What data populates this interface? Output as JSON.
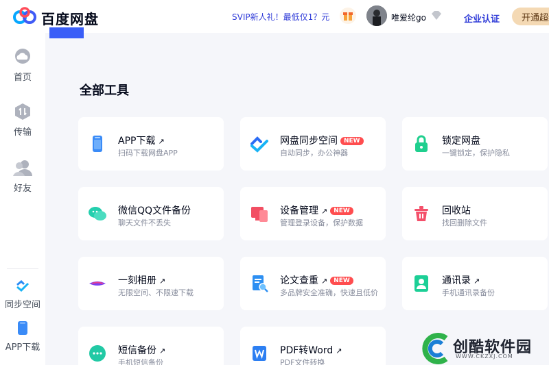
{
  "header": {
    "brand": "百度网盘",
    "promo": "SVIP新人礼！最低仅1？元",
    "username": "唯爱纶go",
    "enterprise": "企业认证",
    "open_button": "开通超级"
  },
  "sidebar": {
    "items": [
      {
        "label": "首页",
        "icon": "cloud-icon"
      },
      {
        "label": "传输",
        "icon": "transfer-icon"
      },
      {
        "label": "好友",
        "icon": "friends-icon"
      }
    ],
    "bottom": [
      {
        "label": "同步空间",
        "icon": "sync-icon"
      },
      {
        "label": "APP下载",
        "icon": "phone-icon"
      }
    ]
  },
  "main": {
    "title": "全部工具",
    "tools": [
      {
        "name": "APP下载",
        "desc": "扫码下载网盘APP",
        "arrow": "↗",
        "icon": "phone-icon",
        "color": "#3a8bf7"
      },
      {
        "name": "网盘同步空间",
        "desc": "自动同步，办公神器",
        "badge": "NEW",
        "icon": "sync-icon",
        "color": "#2b8cf5"
      },
      {
        "name": "锁定网盘",
        "desc": "一键锁定，保护隐私",
        "icon": "lock-icon",
        "color": "#1fcf8e"
      },
      {
        "name": "微信QQ文件备份",
        "desc": "聊天文件不丢失",
        "icon": "chat-icon",
        "color": "#24cfae"
      },
      {
        "name": "设备管理",
        "desc": "管理登录设备，保护数据",
        "arrow": "↗",
        "badge": "NEW",
        "icon": "devices-icon",
        "color": "#f24f63"
      },
      {
        "name": "回收站",
        "desc": "找回删除文件",
        "icon": "trash-icon",
        "color": "#f4506a"
      },
      {
        "name": "一刻相册",
        "desc": "无限空间、不限速下载",
        "arrow": "↗",
        "icon": "album-icon",
        "color": "#7b3ff2"
      },
      {
        "name": "论文查重",
        "desc": "多品牌安全准确，快速且低价",
        "arrow": "↗",
        "badge": "NEW",
        "icon": "paper-search-icon",
        "color": "#2d8ff2"
      },
      {
        "name": "通讯录",
        "desc": "手机通讯录备份",
        "arrow": "↗",
        "icon": "contact-icon",
        "color": "#1ccf96"
      },
      {
        "name": "短信备份",
        "desc": "手机短信备份",
        "arrow": "↗",
        "icon": "sms-icon",
        "color": "#22c9a5"
      },
      {
        "name": "PDF转Word",
        "desc": "PDF文件转换",
        "arrow": "↗",
        "icon": "word-icon",
        "color": "#2d7ff2"
      }
    ]
  },
  "watermark": {
    "text": "创酷软件园",
    "url": "WWW.CKZXJ.COM"
  }
}
